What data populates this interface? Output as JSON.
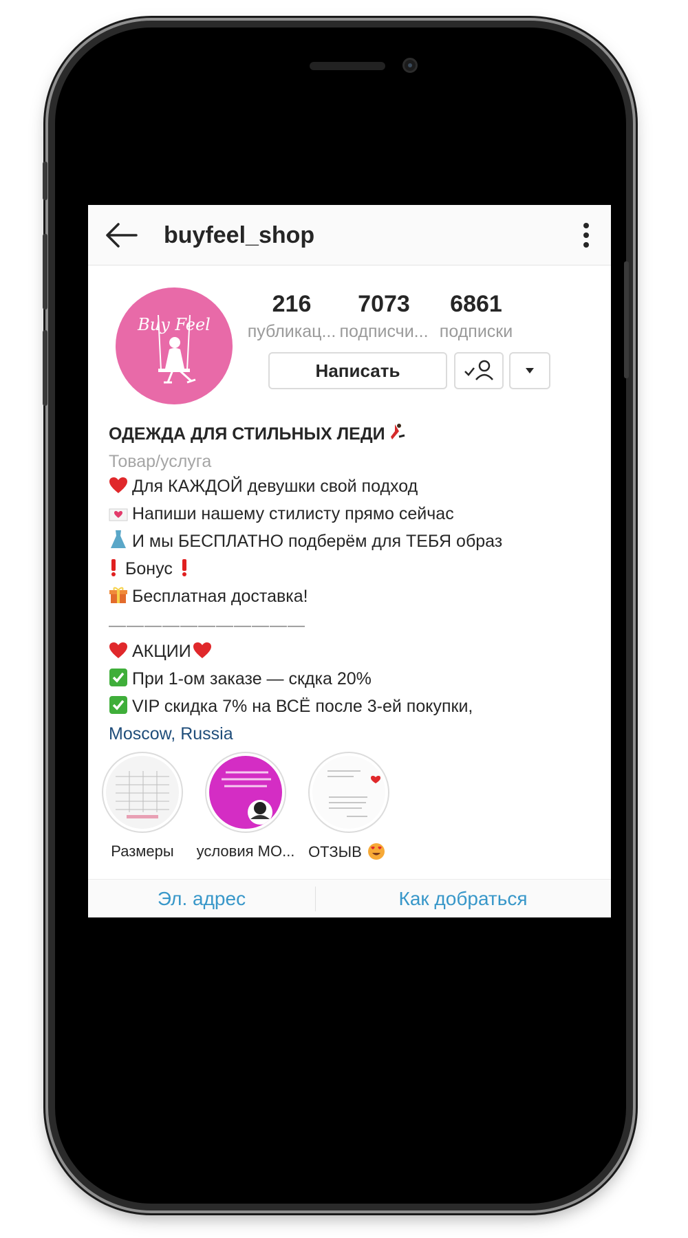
{
  "header": {
    "username": "buyfeel_shop"
  },
  "profile": {
    "avatar_text": "Buy Feel",
    "stats": [
      {
        "value": "216",
        "label": "публикац..."
      },
      {
        "value": "7073",
        "label": "подписчи..."
      },
      {
        "value": "6861",
        "label": "подписки"
      }
    ],
    "message_button": "Написать"
  },
  "bio": {
    "title": "ОДЕЖДА ДЛЯ СТИЛЬНЫХ ЛЕДИ",
    "category": "Товар/услуга",
    "lines": [
      "Для КАЖДОЙ девушки свой подход",
      "Напиши нашему стилисту прямо сейчас",
      "И мы БЕСПЛАТНО подберём для ТЕБЯ образ",
      "Бонус",
      "Бесплатная доставка!"
    ],
    "divider": "———————————",
    "promo_title": "АКЦИИ",
    "promo_lines": [
      "При 1-ом заказе — скдка 20%",
      "VIP скидка 7% на ВСЁ после 3-ей покупки,"
    ],
    "location": "Moscow, Russia"
  },
  "highlights": [
    {
      "label": "Размеры"
    },
    {
      "label": "условия МО..."
    },
    {
      "label": "ОТЗЫВ"
    }
  ],
  "contact": {
    "email_label": "Эл. адрес",
    "directions_label": "Как добраться"
  },
  "colors": {
    "avatar_pink": "#e86aa8",
    "link_blue": "#3897c9",
    "highlight_magenta": "#d42dc4"
  }
}
